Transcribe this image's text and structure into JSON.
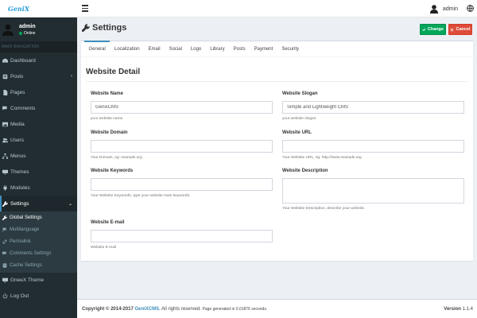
{
  "brand": {
    "logo_text": "GeniX"
  },
  "sidebar": {
    "user": {
      "name": "admin",
      "status": "Online"
    },
    "nav_header": "MAIN NAVIGATION",
    "items": [
      {
        "label": "Dashboard",
        "icon": "dashboard-icon"
      },
      {
        "label": "Posts",
        "icon": "posts-icon"
      },
      {
        "label": "Pages",
        "icon": "file-icon"
      },
      {
        "label": "Comments",
        "icon": "comments-icon"
      },
      {
        "label": "Media",
        "icon": "image-icon"
      },
      {
        "label": "Users",
        "icon": "users-icon"
      },
      {
        "label": "Menus",
        "icon": "sitemap-icon"
      },
      {
        "label": "Themes",
        "icon": "desktop-icon"
      },
      {
        "label": "Modules",
        "icon": "plug-icon"
      },
      {
        "label": "Settings",
        "icon": "wrench-icon"
      }
    ],
    "settings_sub": [
      {
        "label": "Global Settings",
        "icon": "wrench-icon"
      },
      {
        "label": "Multilanguage",
        "icon": "flag-icon"
      },
      {
        "label": "Permalink",
        "icon": "link-icon"
      },
      {
        "label": "Comments Settings",
        "icon": "comments-icon"
      },
      {
        "label": "Cache Settings",
        "icon": "database-icon"
      }
    ],
    "theme_item": {
      "label": "GneeX Theme",
      "icon": "desktop-icon"
    },
    "logout_item": {
      "label": "Log Out",
      "icon": "power-icon"
    }
  },
  "topbar": {
    "user_name": "admin"
  },
  "header": {
    "title": "Settings",
    "change_label": "Change",
    "cancel_label": "Cancel"
  },
  "tabs": [
    "General",
    "Localization",
    "Email",
    "Social",
    "Logo",
    "Library",
    "Posts",
    "Payment",
    "Security"
  ],
  "section_title": "Website Detail",
  "fields": {
    "site_name": {
      "label": "Website Name",
      "value": "GenixCMS",
      "help": "your website name"
    },
    "site_slogan": {
      "label": "Website Slogan",
      "value": "Simple and Lightweight CMS",
      "help": "your website slogan"
    },
    "site_domain": {
      "label": "Website Domain",
      "value": "",
      "help": "Your Domain, eg: example.org"
    },
    "site_url": {
      "label": "Website URL",
      "value": "",
      "help": "Your Website URL, eg: http://www.example.org"
    },
    "site_keywords": {
      "label": "Website Keywords",
      "value": "",
      "help": "Your Website Keywords, type your website main keywords."
    },
    "site_description": {
      "label": "Website Description",
      "value": "",
      "help": "Your Website Description, describe your website."
    },
    "site_email": {
      "label": "Website E-mail",
      "value": "",
      "help": "Website E-mail"
    }
  },
  "footer": {
    "copyright": "Copyright © 2014-2017",
    "brand": "GeniXCMS.",
    "rights": "All rights reserved.",
    "generated": "Page generated in 0.01876 seconds.",
    "version_label": "Version",
    "version": "1.1.4"
  },
  "colors": {
    "accent": "#3c8dbc",
    "sidebar_bg": "#222d32",
    "success": "#00a65a",
    "danger": "#dd4b39"
  }
}
